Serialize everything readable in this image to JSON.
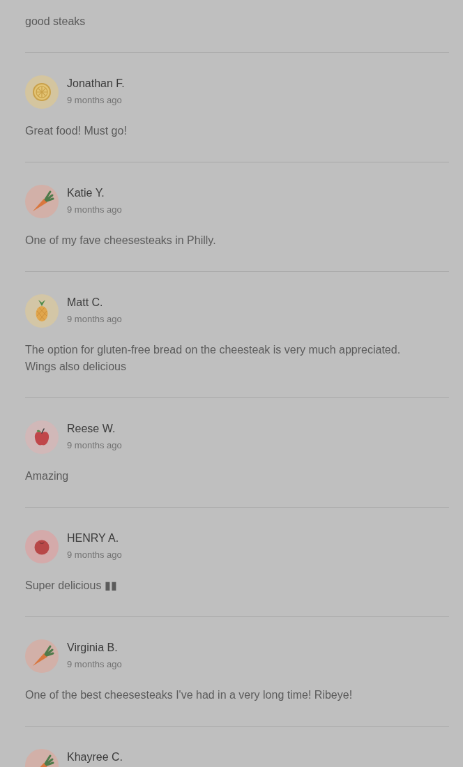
{
  "reviews": [
    {
      "text": "good steaks"
    },
    {
      "avatar": {
        "kind": "lemon"
      },
      "name": "Jonathan F.",
      "time": "9 months ago",
      "text": "Great food! Must go!"
    },
    {
      "avatar": {
        "kind": "carrot"
      },
      "name": "Katie Y.",
      "time": "9 months ago",
      "text": "One of my fave cheesesteaks in Philly."
    },
    {
      "avatar": {
        "kind": "pineapple"
      },
      "name": "Matt C.",
      "time": "9 months ago",
      "text": "The option for gluten-free bread on the cheesteak is very much appreciated. Wings also delicious"
    },
    {
      "avatar": {
        "kind": "apple"
      },
      "name": "Reese W.",
      "time": "9 months ago",
      "text": "Amazing"
    },
    {
      "avatar": {
        "kind": "tomato"
      },
      "name": "HENRY A.",
      "time": "9 months ago",
      "text": "Super delicious ▮▮"
    },
    {
      "avatar": {
        "kind": "carrot"
      },
      "name": "Virginia B.",
      "time": "9 months ago",
      "text": "One of the best cheesesteaks I've had in a very long time! Ribeye!"
    },
    {
      "avatar": {
        "kind": "carrot"
      },
      "name": "Khayree C."
    }
  ]
}
